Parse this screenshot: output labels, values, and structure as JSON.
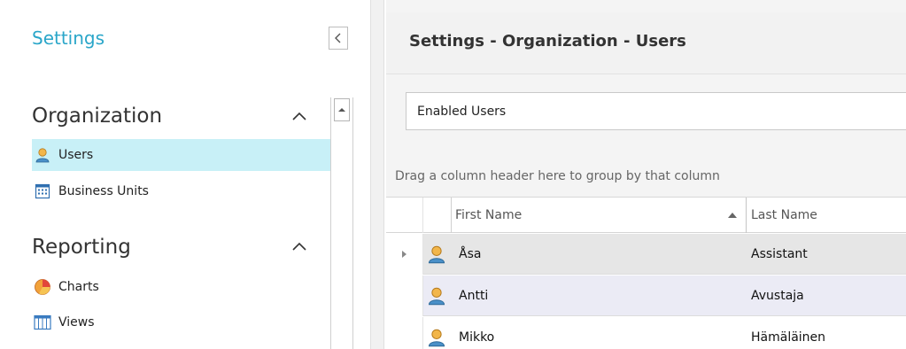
{
  "sidebar": {
    "title": "Settings",
    "groups": [
      {
        "label": "Organization",
        "items": [
          {
            "label": "Users",
            "icon": "user-icon",
            "selected": true
          },
          {
            "label": "Business Units",
            "icon": "building-icon",
            "selected": false
          }
        ]
      },
      {
        "label": "Reporting",
        "items": [
          {
            "label": "Charts",
            "icon": "pie-chart-icon",
            "selected": false
          },
          {
            "label": "Views",
            "icon": "table-view-icon",
            "selected": false
          }
        ]
      }
    ]
  },
  "main": {
    "title": "Settings - Organization - Users",
    "view_selector": {
      "value": "Enabled Users"
    },
    "group_panel_hint": "Drag a column header here to group by that column",
    "grid": {
      "columns": [
        "First Name",
        "Last Name"
      ],
      "sorted_column": "First Name",
      "sort_direction": "ascending",
      "rows": [
        {
          "first_name": "Åsa",
          "last_name": "Assistant"
        },
        {
          "first_name": "Antti",
          "last_name": "Avustaja"
        },
        {
          "first_name": "Mikko",
          "last_name": "Hämäläinen"
        }
      ]
    }
  },
  "colors": {
    "accent": "#2aa6c9",
    "selected_nav": "#c8f0f7",
    "focused_row": "#e6e6e6",
    "alt_row": "#ebebf5"
  }
}
